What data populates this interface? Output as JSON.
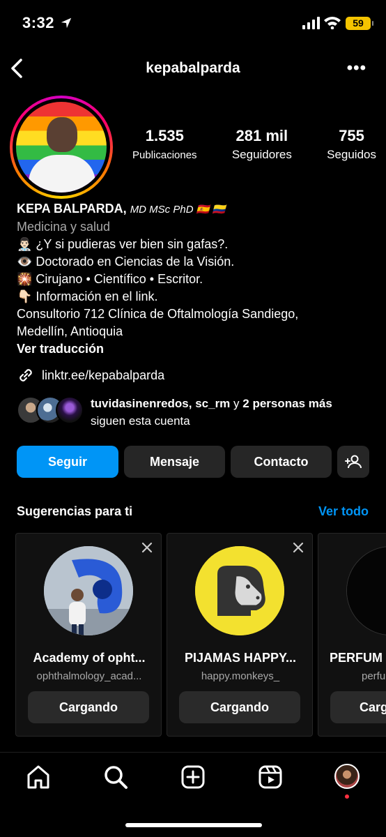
{
  "status_bar": {
    "time": "3:32",
    "battery": "59"
  },
  "header": {
    "username": "kepabalparda"
  },
  "profile": {
    "stats": [
      {
        "value": "1.535",
        "label": "Publicaciones"
      },
      {
        "value": "281 mil",
        "label": "Seguidores"
      },
      {
        "value": "755",
        "label": "Seguidos"
      }
    ],
    "name": "KEPA BALPARDA,",
    "name_suffix": "MD MSc PhD 🇪🇸 🇨🇴",
    "category": "Medicina y salud",
    "bio_lines": [
      "👨🏻‍⚕️ ¿Y si pudieras ver bien sin gafas?.",
      "👁️ Doctorado en Ciencias de la Visión.",
      "🎇 Cirujano • Científico • Escritor.",
      "👇🏻 Información en el link.",
      "Consultorio 712 Clínica de Oftalmología Sandiego,",
      "Medellín, Antioquia"
    ],
    "translate": "Ver traducción",
    "link": "linktr.ee/kepabalparda",
    "followed_by_names": "tuvidasinenredos, sc_rm",
    "followed_by_and": "y",
    "followed_by_more": "2 personas más",
    "followed_by_suffix": "siguen esta cuenta"
  },
  "actions": {
    "follow": "Seguir",
    "message": "Mensaje",
    "contact": "Contacto"
  },
  "suggestions": {
    "title": "Sugerencias para ti",
    "see_all": "Ver todo",
    "cards": [
      {
        "name": "Academy of opht...",
        "handle": "ophthalmology_acad...",
        "button": "Cargando"
      },
      {
        "name": "PIJAMAS HAPPY...",
        "handle": "happy.monkeys_",
        "button": "Cargando"
      },
      {
        "name": "PERFUM",
        "handle": "perfu",
        "button": "Carg"
      }
    ]
  },
  "nav": {
    "icons": [
      "home-icon",
      "search-icon",
      "create-icon",
      "reels-icon",
      "profile-avatar"
    ]
  },
  "colors": {
    "accent": "#0095f6",
    "surface": "#262626",
    "muted": "#a8a8a8"
  }
}
